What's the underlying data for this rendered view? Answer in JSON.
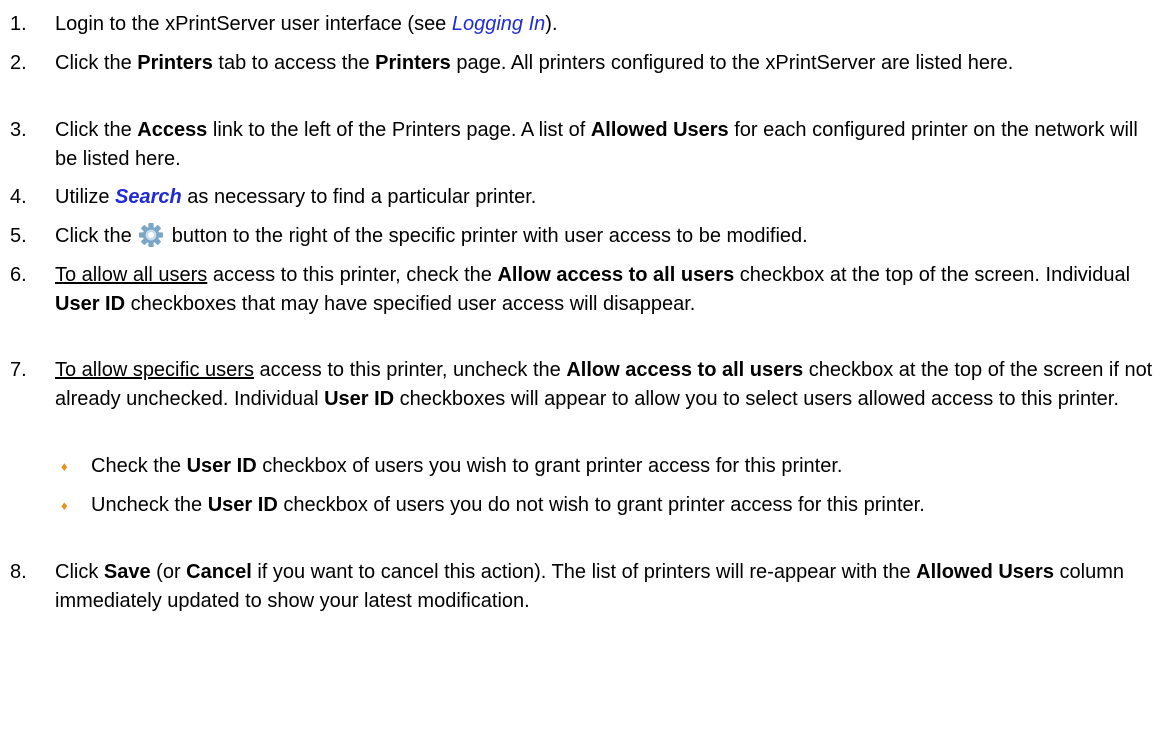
{
  "colors": {
    "link": "#1f2bd8",
    "bullet": "#e8901a",
    "gear_fill": "#7aa7c7",
    "gear_light": "#c8dbe8"
  },
  "steps": [
    {
      "num": "1.",
      "t1": "Login to the xPrintServer user interface (see ",
      "link": "Logging In",
      "t2": ")."
    },
    {
      "num": "2.",
      "t1": "Click the ",
      "b1": "Printers",
      "t2": " tab to access the ",
      "b2": "Printers",
      "t3": " page.  All printers configured to the xPrintServer are listed here."
    },
    {
      "num": "3.",
      "t1": "Click the ",
      "b1": "Access",
      "t2": " link to the left of the Printers page.  A list of ",
      "b2": "Allowed Users",
      "t3": " for each configured printer on the network will be listed here."
    },
    {
      "num": "4.",
      "t1": "Utilize ",
      "link": "Search",
      "t2": " as necessary to find a particular printer."
    },
    {
      "num": "5.",
      "t1": "Click the ",
      "icon": "gear-icon",
      "t2": " button to the right of the specific printer with user access to be modified."
    },
    {
      "num": "6.",
      "u1": "To allow all users",
      "t1": " access to this printer, check the ",
      "b1": "Allow access to all users",
      "t2": " checkbox at the top of the screen. Individual ",
      "b2": "User ID",
      "t3": " checkboxes that may have specified user access will disappear."
    },
    {
      "num": "7.",
      "u1": "To allow specific users",
      "t1": " access to this printer, uncheck the ",
      "b1": "Allow access to all users",
      "t2": " checkbox at the top of the screen if not already unchecked.  Individual ",
      "b2": "User ID",
      "t3": " checkboxes will appear to allow you to select users allowed access to this printer."
    },
    {
      "num": "8.",
      "t1": "Click ",
      "b1": "Save",
      "t2": " (or ",
      "b2": "Cancel",
      "t3": " if you want to cancel this action).  The list of printers will re-appear with the ",
      "b3": "Allowed Users",
      "t4": " column immediately updated to show your latest modification."
    }
  ],
  "substeps": [
    {
      "bullet": "♦",
      "t1": "Check the ",
      "b1": "User ID",
      "t2": " checkbox of users you wish to grant printer access for this printer."
    },
    {
      "bullet": "♦",
      "t1": "Uncheck the ",
      "b1": "User ID",
      "t2": " checkbox of users you do not wish to grant printer access for this printer."
    }
  ]
}
